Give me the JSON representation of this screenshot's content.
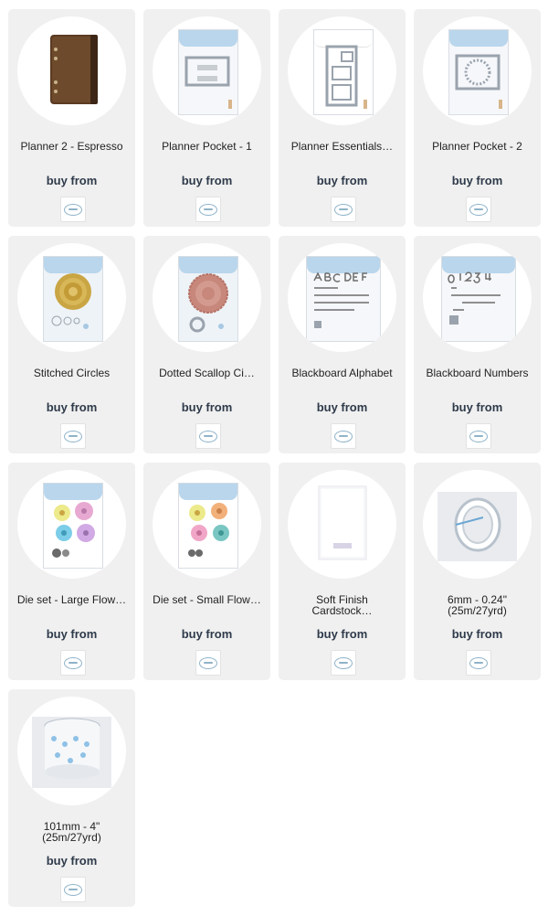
{
  "buy_label": "buy from",
  "store_icon": "elizabeth-craft-designs-logo-icon",
  "products": [
    {
      "name": "Planner 2 - Espresso",
      "thumb": "binder"
    },
    {
      "name": "Planner Pocket - 1",
      "thumb": "die-pocket"
    },
    {
      "name": "Planner Essentials…",
      "thumb": "die-essentials"
    },
    {
      "name": "Planner Pocket - 2",
      "thumb": "die-pocket-wreath"
    },
    {
      "name": "Stitched Circles",
      "thumb": "circles-gold"
    },
    {
      "name": "Dotted Scallop Ci…",
      "thumb": "circles-scallop"
    },
    {
      "name": "Blackboard Alphabet",
      "thumb": "alphabet"
    },
    {
      "name": "Blackboard Numbers",
      "thumb": "numbers"
    },
    {
      "name": "Die set - Large Flow…",
      "thumb": "flowers-large"
    },
    {
      "name": "Die set - Small Flow…",
      "thumb": "flowers-small"
    },
    {
      "name": "Soft Finish\nCardstock…",
      "thumb": "cardstock"
    },
    {
      "name": "6mm - 0.24\"\n(25m/27yrd)",
      "thumb": "tape-small"
    },
    {
      "name": "101mm - 4\"\n(25m/27yrd)",
      "thumb": "tape-large"
    }
  ],
  "colors": {
    "card_bg": "#f0f0f0",
    "buy_text": "#2e3a4a",
    "pack_header": "#b9d6ec"
  }
}
